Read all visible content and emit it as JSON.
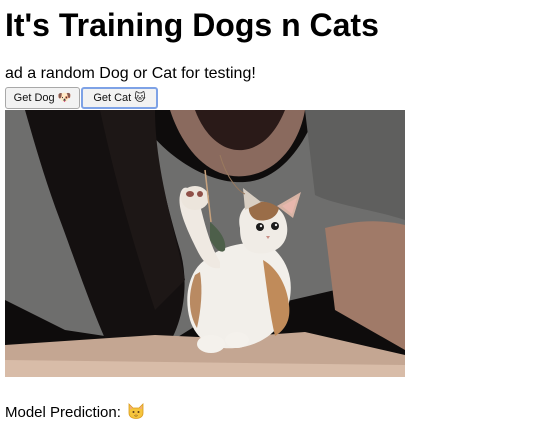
{
  "page": {
    "title": "It's Training Dogs n Cats",
    "subtitle": "ad a random Dog or Cat for testing!"
  },
  "buttons": {
    "get_dog_label": "Get Dog",
    "get_dog_icon": "dog-face-icon",
    "get_cat_label": "Get Cat",
    "get_cat_icon": "cat-face-icon",
    "focused": "get_cat"
  },
  "image": {
    "subject": "kitten-photo"
  },
  "prediction": {
    "label": "Model Prediction:",
    "result_icon": "cat-face-icon"
  },
  "colors": {
    "focus_ring": "#7ea2e6",
    "button_bg": "#f2f2f2",
    "emoji_yellow": "#f6c53c"
  }
}
